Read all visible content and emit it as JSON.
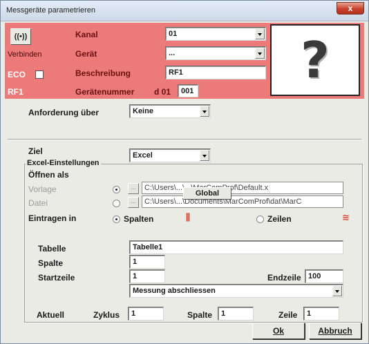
{
  "window": {
    "title": "Messgeräte parametrieren",
    "close_label": "x"
  },
  "device": {
    "icon_label": "((•))",
    "connect_label": "Verbinden",
    "eco_label": "ECO",
    "rf_label": "RF1",
    "kanal_label": "Kanal",
    "kanal_value": "01",
    "geraet_label": "Gerät",
    "geraet_value": "...",
    "beschreibung_label": "Beschreibung",
    "beschreibung_value": "RF1",
    "geraetenummer_label": "Gerätenummer",
    "geraetenummer_prefix": "d 01",
    "geraetenummer_value": "001",
    "image_placeholder": "?"
  },
  "request": {
    "label": "Anforderung über",
    "value": "Keine"
  },
  "target": {
    "label": "Ziel",
    "value": "Excel",
    "group_title": "Excel-Einstellungen",
    "open_label": "Öffnen als",
    "vorlage_label": "Vorlage",
    "vorlage_path": "C:\\Users\\...\\...\\MarComProf\\Default.x",
    "datei_label": "Datei",
    "datei_path": "C:\\Users\\...\\Documents\\MarComProf\\dat\\MarC",
    "browse_label": "...",
    "global_label": "Global",
    "eintragen_label": "Eintragen in",
    "spalten_label": "Spalten",
    "zeilen_label": "Zeilen",
    "tabelle_label": "Tabelle",
    "tabelle_value": "Tabelle1",
    "spalte_label": "Spalte",
    "spalte_value": "1",
    "startzeile_label": "Startzeile",
    "startzeile_value": "1",
    "endzeile_label": "Endzeile",
    "endzeile_value": "100",
    "action_value": "Messung abschliessen"
  },
  "current": {
    "label": "Aktuell",
    "zyklus_label": "Zyklus",
    "zyklus_value": "1",
    "spalte_label": "Spalte",
    "spalte_value": "1",
    "zeile_label": "Zeile",
    "zeile_value": "1"
  },
  "buttons": {
    "ok": "Ok",
    "cancel": "Abbruch"
  }
}
